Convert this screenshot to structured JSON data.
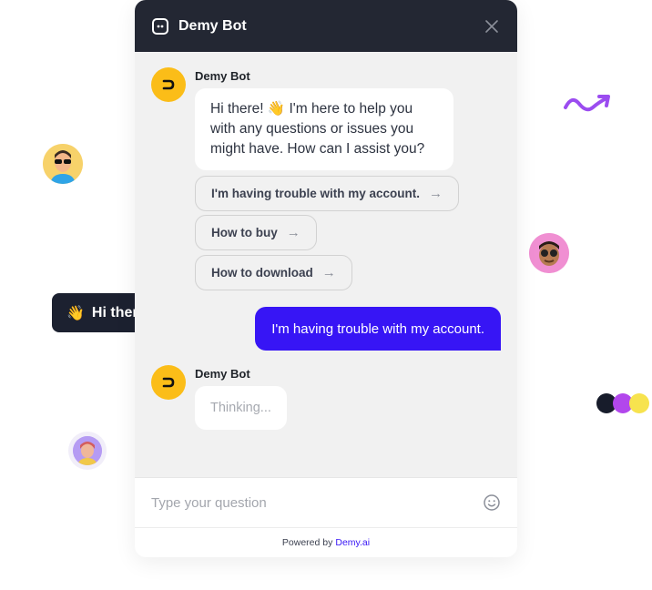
{
  "header": {
    "title": "Demy Bot",
    "close_icon": "close-icon",
    "bot_icon": "bot-icon"
  },
  "messages": {
    "bot_name_1": "Demy Bot",
    "bot_greeting": "Hi there! 👋 I'm here to help you with any questions or issues you might have. How can I assist you?",
    "suggestions": [
      {
        "label": "I'm having trouble with my account.",
        "arrow": "→"
      },
      {
        "label": "How to buy",
        "arrow": "→"
      },
      {
        "label": "How to download",
        "arrow": "→"
      }
    ],
    "user_message": "I'm having trouble with my account.",
    "bot_name_2": "Demy Bot",
    "bot_thinking": "Thinking..."
  },
  "input": {
    "placeholder": "Type your question",
    "emoji_icon": "smile-icon"
  },
  "footer": {
    "powered_by": "Powered by",
    "brand_link": "Demy.ai"
  },
  "decor": {
    "hi_pill_text": "Hi there",
    "hi_pill_emoji": "👋"
  },
  "colors": {
    "header_bg": "#232733",
    "accent": "#3715f5",
    "bot_avatar": "#fbbd18",
    "chat_bg": "#f1f1f1"
  }
}
